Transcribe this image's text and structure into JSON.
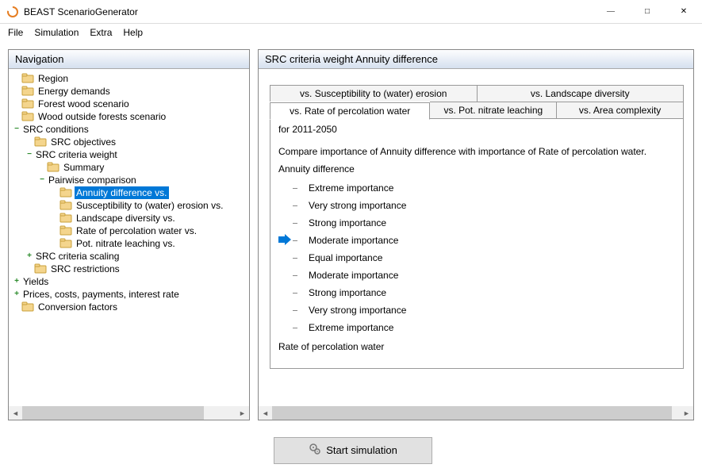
{
  "window": {
    "title": "BEAST ScenarioGenerator"
  },
  "menu": {
    "file": "File",
    "simulation": "Simulation",
    "extra": "Extra",
    "help": "Help"
  },
  "nav": {
    "title": "Navigation",
    "items": {
      "region": "Region",
      "energy": "Energy demands",
      "forest": "Forest wood scenario",
      "woodoutside": "Wood outside forests scenario",
      "srcconditions": "SRC conditions",
      "srcobjectives": "SRC objectives",
      "srccriteria": "SRC criteria weight",
      "summary": "Summary",
      "pairwise": "Pairwise comparison",
      "annuity": "Annuity difference vs.",
      "susceptibility": "Susceptibility to (water) erosion vs.",
      "landscape": "Landscape diversity vs.",
      "percolation": "Rate of percolation water vs.",
      "nitrate": "Pot. nitrate leaching vs.",
      "scaling": "SRC criteria scaling",
      "restrictions": "SRC restrictions",
      "yields": "Yields",
      "prices": "Prices, costs, payments, interest rate",
      "conversion": "Conversion factors"
    }
  },
  "main": {
    "title": "SRC criteria weight Annuity difference",
    "tabs_top": {
      "susceptibility": "vs. Susceptibility to (water) erosion",
      "landscape": "vs. Landscape diversity"
    },
    "tabs_bottom": {
      "percolation": "vs. Rate of percolation water",
      "nitrate": "vs. Pot. nitrate leaching",
      "area": "vs. Area complexity"
    },
    "for_period": "for 2011-2050",
    "compare": "Compare importance of Annuity difference with importance of Rate of percolation water.",
    "top_label": "Annuity difference",
    "bottom_label": "Rate of percolation water",
    "scale": [
      "Extreme importance",
      "Very strong importance",
      "Strong importance",
      "Moderate importance",
      "Equal importance",
      "Moderate importance",
      "Strong importance",
      "Very strong importance",
      "Extreme importance"
    ],
    "selected_index": 3
  },
  "footer": {
    "start": "Start simulation"
  }
}
